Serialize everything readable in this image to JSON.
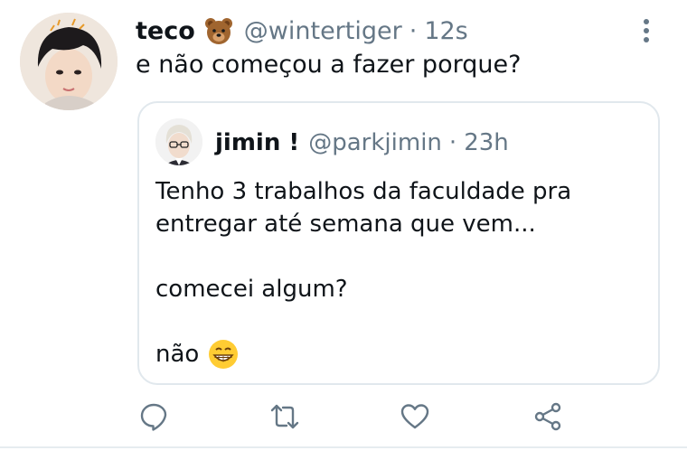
{
  "tweet": {
    "author": {
      "display_name": "teco",
      "name_emoji": "bear-face-icon",
      "handle": "@wintertiger",
      "separator": "·",
      "time": "12s"
    },
    "text": "e não começou a fazer porque?",
    "more_icon": "more-vertical-icon"
  },
  "quoted_tweet": {
    "author": {
      "display_name": "jimin !",
      "handle": "@parkjimin",
      "separator": "·",
      "time": "23h"
    },
    "lines": [
      "Tenho 3 trabalhos da faculdade pra",
      "entregar até semana que vem...",
      "comecei algum?",
      "não"
    ],
    "trailing_emoji": "grinning-face-icon"
  },
  "actions": [
    "reply-icon",
    "retweet-icon",
    "like-icon",
    "share-icon"
  ],
  "colors": {
    "text": "#0f1419",
    "secondary": "#657786",
    "border": "#e1e8ed",
    "icon": "#657786"
  }
}
